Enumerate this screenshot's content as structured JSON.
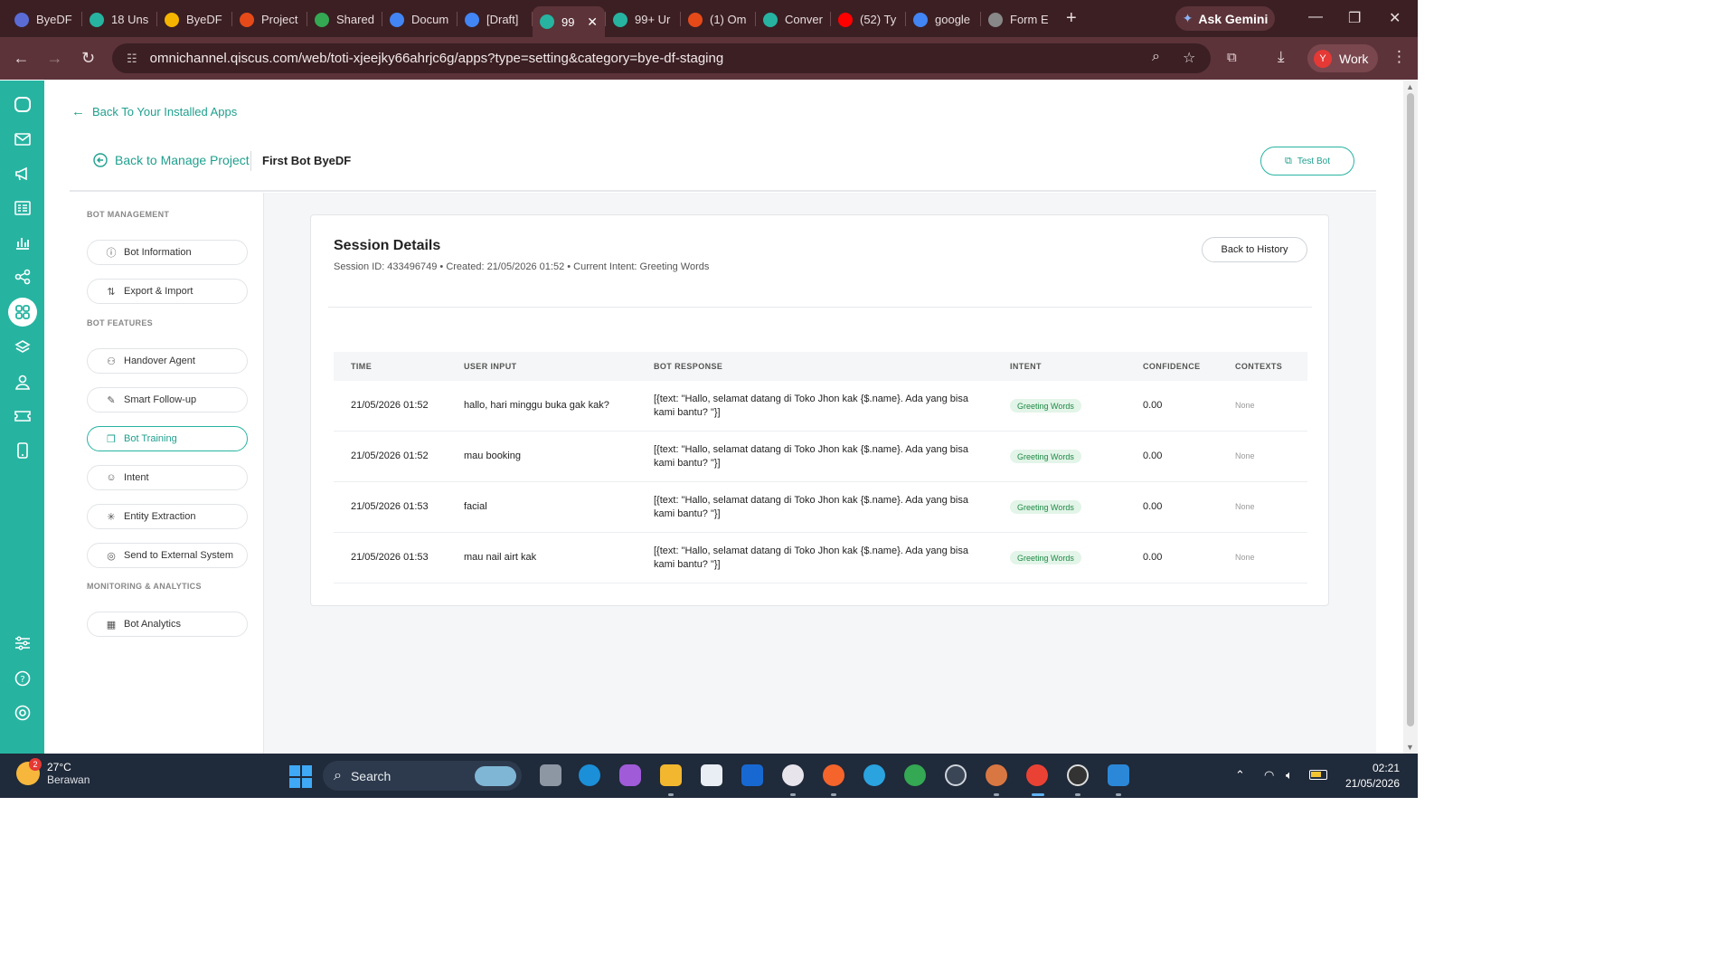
{
  "browser": {
    "tabs": [
      {
        "title": "ByeDF",
        "color": "#5b6bd6"
      },
      {
        "title": "18 Uns",
        "color": "#26b4a1"
      },
      {
        "title": "ByeDF",
        "color": "#f4b400"
      },
      {
        "title": "Project",
        "color": "#e64a19"
      },
      {
        "title": "Shared",
        "color": "#34a853"
      },
      {
        "title": "Docum",
        "color": "#4285f4"
      },
      {
        "title": "[Draft]",
        "color": "#4285f4"
      },
      {
        "title": "99",
        "color": "#26b4a1",
        "active": true
      },
      {
        "title": "99+ Ur",
        "color": "#26b4a1"
      },
      {
        "title": "(1) Om",
        "color": "#e64a19"
      },
      {
        "title": "Conver",
        "color": "#26b4a1"
      },
      {
        "title": "(52) Ty",
        "color": "#ff0000"
      },
      {
        "title": "google",
        "color": "#4285f4"
      },
      {
        "title": "Form E",
        "color": "#888888"
      }
    ],
    "new_tab": "+",
    "gemini_label": "Ask Gemini",
    "url": "omnichannel.qiscus.com/web/toti-xjeejky66ahrjc6g/apps?type=setting&category=bye-df-staging",
    "profile_initial": "Y",
    "profile_label": "Work"
  },
  "nav": {
    "back_installed": "Back To Your Installed Apps",
    "back_manage": "Back to Manage Project",
    "bot_name": "First Bot ByeDF",
    "test_bot": "Test Bot"
  },
  "sidebar": {
    "sections": [
      {
        "title": "BOT MANAGEMENT",
        "items": [
          {
            "label": "Bot Information",
            "icon": "info-icon"
          },
          {
            "label": "Export & Import",
            "icon": "swap-icon"
          }
        ]
      },
      {
        "title": "BOT FEATURES",
        "items": [
          {
            "label": "Handover Agent",
            "icon": "user-icon"
          },
          {
            "label": "Smart Follow-up",
            "icon": "follow-up-icon"
          },
          {
            "label": "Bot Training",
            "icon": "book-icon",
            "active": true
          },
          {
            "label": "Intent",
            "icon": "robot-icon"
          },
          {
            "label": "Entity Extraction",
            "icon": "sparkle-icon"
          },
          {
            "label": "Send to External System",
            "icon": "target-icon"
          }
        ]
      },
      {
        "title": "MONITORING & ANALYTICS",
        "items": [
          {
            "label": "Bot Analytics",
            "icon": "analytics-icon"
          }
        ]
      }
    ]
  },
  "session": {
    "title": "Session Details",
    "subtitle": "Session ID: 433496749 • Created: 21/05/2026 01:52 • Current Intent: Greeting Words",
    "back_history": "Back to History",
    "columns": [
      "TIME",
      "USER INPUT",
      "BOT RESPONSE",
      "INTENT",
      "CONFIDENCE",
      "CONTEXTS"
    ],
    "rows": [
      {
        "time": "21/05/2026 01:52",
        "input": "hallo, hari minggu buka gak kak?",
        "response": "[{text: \"Hallo, selamat datang di Toko Jhon kak {$.name}. Ada yang bisa kami bantu? \"}]",
        "intent": "Greeting Words",
        "confidence": "0.00",
        "contexts": "None"
      },
      {
        "time": "21/05/2026 01:52",
        "input": "mau booking",
        "response": "[{text: \"Hallo, selamat datang di Toko Jhon kak {$.name}. Ada yang bisa kami bantu? \"}]",
        "intent": "Greeting Words",
        "confidence": "0.00",
        "contexts": "None"
      },
      {
        "time": "21/05/2026 01:53",
        "input": "facial",
        "response": "[{text: \"Hallo, selamat datang di Toko Jhon kak {$.name}. Ada yang bisa kami bantu? \"}]",
        "intent": "Greeting Words",
        "confidence": "0.00",
        "contexts": "None"
      },
      {
        "time": "21/05/2026 01:53",
        "input": "mau nail airt kak",
        "response": "[{text: \"Hallo, selamat datang di Toko Jhon kak {$.name}. Ada yang bisa kami bantu? \"}]",
        "intent": "Greeting Words",
        "confidence": "0.00",
        "contexts": "None"
      }
    ]
  },
  "taskbar": {
    "weather_temp": "27°C",
    "weather_desc": "Berawan",
    "weather_badge": "2",
    "search_label": "Search",
    "time": "02:21",
    "date": "21/05/2026"
  }
}
